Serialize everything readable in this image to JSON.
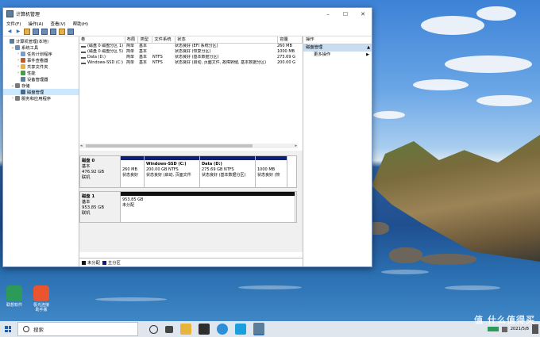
{
  "window": {
    "title": "计算机管理",
    "minimize": "–",
    "maximize": "☐",
    "close": "✕"
  },
  "menu": [
    "文件(F)",
    "操作(A)",
    "查看(V)",
    "帮助(H)"
  ],
  "tree": [
    {
      "label": "计算机管理(本地)",
      "indent": 0,
      "expander": "",
      "color": "#5a7e9c"
    },
    {
      "label": "系统工具",
      "indent": 1,
      "expander": "⌄",
      "color": "#6d8cb4"
    },
    {
      "label": "任务计划程序",
      "indent": 2,
      "expander": "›",
      "color": "#7b9cc8"
    },
    {
      "label": "事件查看器",
      "indent": 2,
      "expander": "›",
      "color": "#c05a2a"
    },
    {
      "label": "共享文件夹",
      "indent": 2,
      "expander": "›",
      "color": "#e4b04c"
    },
    {
      "label": "性能",
      "indent": 2,
      "expander": "›",
      "color": "#4a9a4a"
    },
    {
      "label": "设备管理器",
      "indent": 2,
      "expander": "",
      "color": "#5a7e9c"
    },
    {
      "label": "存储",
      "indent": 1,
      "expander": "⌄",
      "color": "#7a7a7a"
    },
    {
      "label": "磁盘管理",
      "indent": 2,
      "expander": "",
      "color": "#4a6a8a",
      "selected": true
    },
    {
      "label": "服务和应用程序",
      "indent": 1,
      "expander": "›",
      "color": "#7a7a7a"
    }
  ],
  "volume_table": {
    "headers": [
      "卷",
      "布局",
      "类型",
      "文件系统",
      "状态",
      "容量"
    ],
    "rows": [
      [
        "(磁盘 0 磁盘分区 1)",
        "简单",
        "基本",
        "",
        "状态良好 (EFI 系统分区)",
        "260 MB"
      ],
      [
        "(磁盘 0 磁盘分区 5)",
        "简单",
        "基本",
        "",
        "状态良好 (恢复分区)",
        "1000 MB"
      ],
      [
        "Data (D:)",
        "简单",
        "基本",
        "NTFS",
        "状态良好 (基本数据分区)",
        "275.69 G"
      ],
      [
        "Windows-SSD (C:)",
        "简单",
        "基本",
        "NTFS",
        "状态良好 (启动, 页面文件, 故障转储, 基本数据分区)",
        "200.00 G"
      ]
    ]
  },
  "disks": [
    {
      "name": "磁盘 0",
      "type": "基本",
      "size": "476.92 GB",
      "status": "联机",
      "partitions": [
        {
          "title": "",
          "size": "260 MB",
          "status": "状态良好",
          "width": 30
        },
        {
          "title": "Windows-SSD  (C:)",
          "size": "200.00 GB NTFS",
          "status": "状态良好 (启动, 页面文件",
          "width": 70
        },
        {
          "title": "Data  (D:)",
          "size": "275.69 GB NTFS",
          "status": "状态良好 (基本数据分区)",
          "width": 70
        },
        {
          "title": "",
          "size": "1000 MB",
          "status": "状态良好 (恢",
          "width": 40
        }
      ]
    },
    {
      "name": "磁盘 1",
      "type": "基本",
      "size": "953.85 GB",
      "status": "联机",
      "partitions": [
        {
          "title": "",
          "size": "953.85 GB",
          "status": "未分配",
          "width": 220,
          "unallocated": true
        }
      ]
    }
  ],
  "legend": [
    {
      "label": "未分配",
      "color": "#111111"
    },
    {
      "label": "主分区",
      "color": "#0c1f7a"
    }
  ],
  "actions": {
    "title": "操作",
    "group": "磁盘管理",
    "items": [
      "更多操作"
    ]
  },
  "desktop_icons": [
    {
      "label": "联想软件",
      "color": "#2c9b5a"
    },
    {
      "label": "极光连接\n助手版",
      "color": "#e8552e"
    }
  ],
  "taskbar": {
    "search_placeholder": "搜索",
    "clock_time": "",
    "clock_date": "2021/5/8",
    "watermark": "值 什么值得买"
  }
}
